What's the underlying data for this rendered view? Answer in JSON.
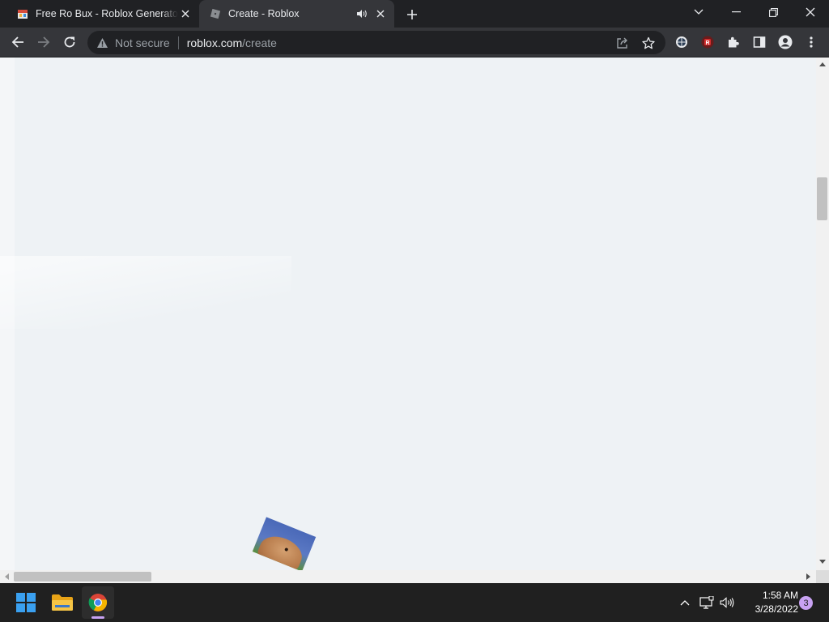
{
  "browser": {
    "tabs": [
      {
        "title": "Free Ro Bux - Roblox Generator -",
        "active": false,
        "favicon": "roblox-generator-favicon"
      },
      {
        "title": "Create - Roblox",
        "active": true,
        "favicon": "roblox-favicon",
        "audio": true
      }
    ],
    "address_bar": {
      "security_label": "Not secure",
      "host": "roblox.com",
      "path": "/create"
    }
  },
  "taskbar": {
    "apps": [
      "windows-start",
      "file-explorer",
      "google-chrome"
    ],
    "clock": {
      "time": "1:58 AM",
      "date": "3/28/2022"
    },
    "notification_count": "3"
  },
  "colors": {
    "chrome_dark": "#202124",
    "toolbar": "#35363a",
    "page_bg": "#eef2f5",
    "accent_purple": "#c8a2f2"
  }
}
